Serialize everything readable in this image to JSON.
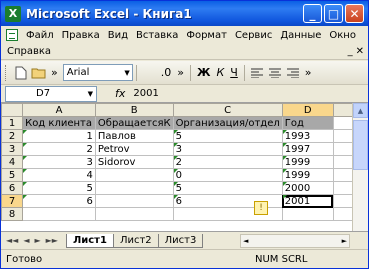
{
  "window": {
    "title": "Microsoft Excel - Книга1",
    "app_icon_letter": "X",
    "minimize": "_",
    "maximize": "□",
    "close": "✕"
  },
  "menubar": {
    "items": [
      "Файл",
      "Правка",
      "Вид",
      "Вставка",
      "Формат",
      "Сервис",
      "Данные",
      "Окно"
    ],
    "row2": [
      "Справка"
    ],
    "mdi_buttons": [
      "_",
      "✕"
    ]
  },
  "toolbar": {
    "font": "Arial",
    "size_decimal": ".0",
    "bold": "Ж",
    "italic": "К",
    "underline": "Ч",
    "chevron": "»",
    "font_dropdown_arrow": "▼"
  },
  "formula_bar": {
    "name_box": "D7",
    "fx": "fx",
    "value": "2001",
    "dropdown_arrow": "▼"
  },
  "grid": {
    "columns": [
      "A",
      "B",
      "C",
      "D"
    ],
    "rows": [
      [
        "Код клиента",
        "ОбращаетсяК",
        "Организация/отдел",
        "Год"
      ],
      [
        "1",
        "Павлов",
        "5",
        "1993"
      ],
      [
        "2",
        "Petrov",
        "3",
        "1997"
      ],
      [
        "3",
        "Sidorov",
        "2",
        "1999"
      ],
      [
        "4",
        "",
        "0",
        "1999"
      ],
      [
        "5",
        "",
        "5",
        "2000"
      ],
      [
        "6",
        "",
        "6",
        "2001"
      ],
      [
        "",
        "",
        "",
        ""
      ]
    ]
  },
  "sheets": {
    "nav": [
      "◄◄",
      "◄",
      "►",
      "►►"
    ],
    "tabs": [
      "Лист1",
      "Лист2",
      "Лист3"
    ],
    "active": "Лист1"
  },
  "status": {
    "text": "Готово",
    "indicators": "NUM SCRL"
  },
  "colors": {
    "title_bar": "#0a5fe4",
    "header_fill": "#a8a8a8",
    "selection_header": "#f9d78c",
    "error_triangle": "#2a8a2a"
  }
}
